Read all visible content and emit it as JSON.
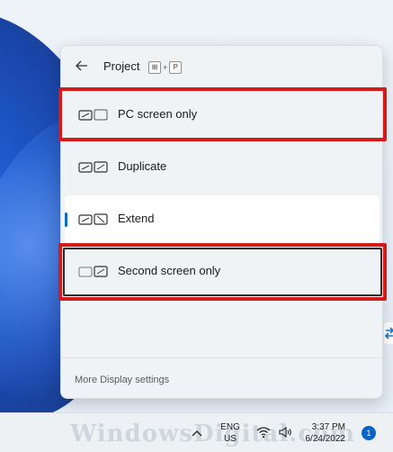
{
  "flyout": {
    "title": "Project",
    "shortcut": {
      "keys": [
        "⊞",
        "P"
      ],
      "separator": "+"
    },
    "options": [
      {
        "label": "PC screen only",
        "icon": "pc-screen-only-icon",
        "selected": false,
        "highlighted": true
      },
      {
        "label": "Duplicate",
        "icon": "duplicate-icon",
        "selected": false,
        "highlighted": false
      },
      {
        "label": "Extend",
        "icon": "extend-icon",
        "selected": true,
        "highlighted": false
      },
      {
        "label": "Second screen only",
        "icon": "second-screen-only-icon",
        "selected": false,
        "highlighted": true
      }
    ],
    "footer_link": "More Display settings"
  },
  "taskbar": {
    "language": {
      "line1": "ENG",
      "line2": "US"
    },
    "time": "3:37 PM",
    "date": "6/24/2022",
    "notification_count": "1",
    "watermark": "WindowsDigital.com"
  },
  "colors": {
    "accent": "#0b6cbd",
    "highlight": "#d51a1a",
    "panel_bg": "#f0f3f6",
    "selected_bg": "#ffffff"
  }
}
